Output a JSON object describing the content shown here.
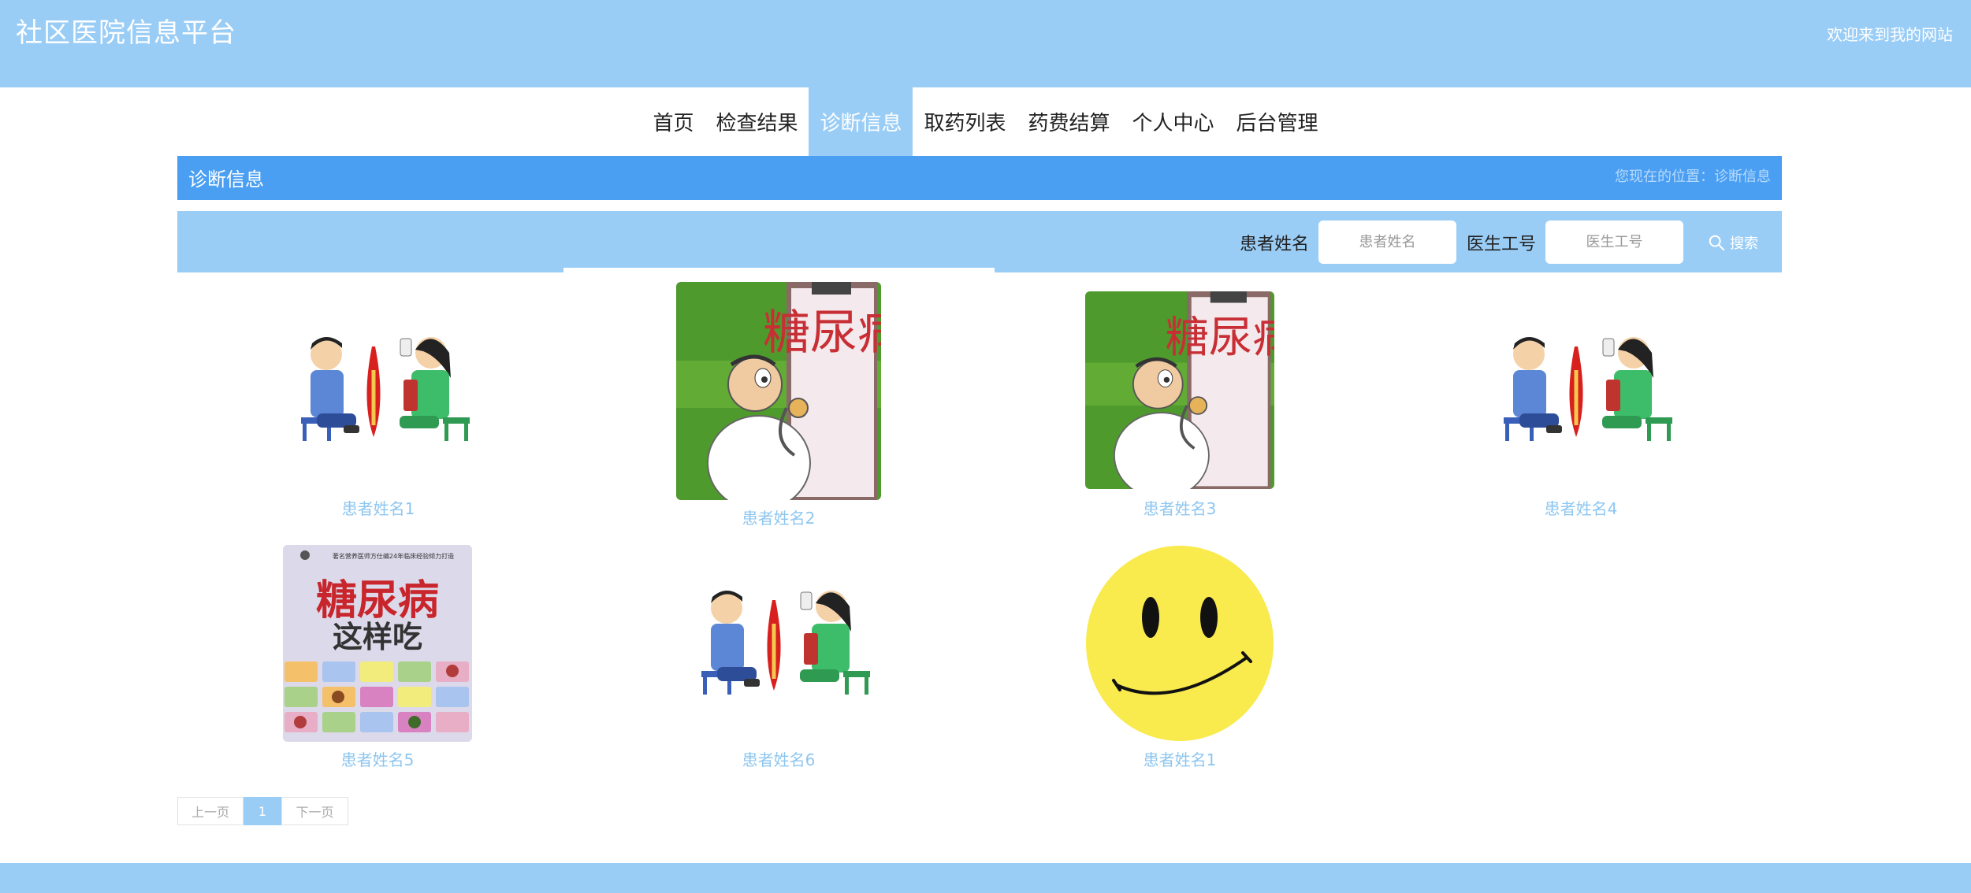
{
  "header": {
    "title": "社区医院信息平台",
    "welcome": "欢迎来到我的网站"
  },
  "nav": {
    "items": [
      {
        "label": "首页"
      },
      {
        "label": "检查结果"
      },
      {
        "label": "诊断信息"
      },
      {
        "label": "取药列表"
      },
      {
        "label": "药费结算"
      },
      {
        "label": "个人中心"
      },
      {
        "label": "后台管理"
      }
    ],
    "active": "诊断信息"
  },
  "section": {
    "title": "诊断信息",
    "location": "您现在的位置：诊断信息"
  },
  "search": {
    "patient_label": "患者姓名",
    "patient_placeholder": "患者姓名",
    "doctor_label": "医生工号",
    "doctor_placeholder": "医生工号",
    "button_label": "搜索"
  },
  "cards": [
    {
      "name": "患者姓名1",
      "image": "cartoon-patients-illustration"
    },
    {
      "name": "患者姓名2",
      "image": "diabetes-doctor-illustration"
    },
    {
      "name": "患者姓名3",
      "image": "diabetes-doctor-illustration"
    },
    {
      "name": "患者姓名4",
      "image": "cartoon-patients-illustration"
    },
    {
      "name": "患者姓名5",
      "image": "diabetes-diet-book-cover"
    },
    {
      "name": "患者姓名6",
      "image": "cartoon-patients-illustration"
    },
    {
      "name": "患者姓名1",
      "image": "smiley-face"
    }
  ],
  "book_cover": {
    "top_text": "著名营养医师方仕编24年临床经验倾力打造",
    "title": "糖尿病",
    "subtitle": "这样吃",
    "sign_text": "糖尿病"
  },
  "pagination": {
    "prev": "上一页",
    "current": "1",
    "next": "下一页"
  },
  "colors": {
    "primary": "#9acdf6",
    "section": "#4a9ff2",
    "link": "#8ec6f0"
  }
}
